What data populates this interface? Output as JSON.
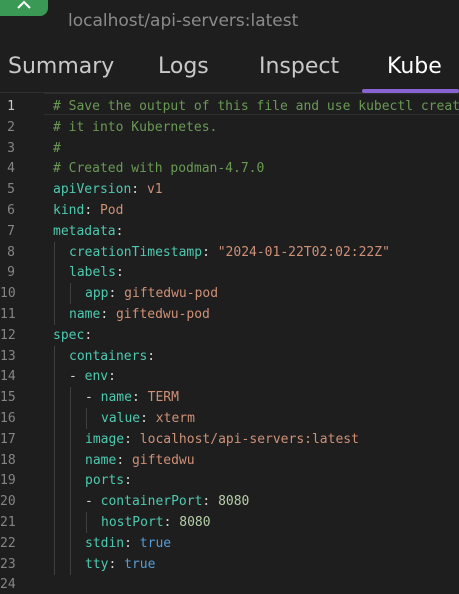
{
  "header": {
    "image_name": "localhost/api-servers:latest"
  },
  "tabs": [
    {
      "label": "Summary"
    },
    {
      "label": "Logs"
    },
    {
      "label": "Inspect"
    },
    {
      "label": "Kube"
    }
  ],
  "active_tab": "Kube",
  "colors": {
    "background": "#1e1e1e",
    "accent": "#8a63d2",
    "container_icon": "#3a9a55",
    "comment": "#6a9955",
    "key": "#4ec9b0",
    "string": "#ce9178",
    "number": "#b5cea8",
    "boolean": "#569cd6"
  },
  "editor": {
    "active_line": 1,
    "lines": [
      {
        "n": "1",
        "indent": 0,
        "tokens": [
          {
            "t": "comment",
            "v": "# Save the output of this file and use kubectl create -f to import"
          }
        ]
      },
      {
        "n": "2",
        "indent": 0,
        "tokens": [
          {
            "t": "comment",
            "v": "# it into Kubernetes."
          }
        ]
      },
      {
        "n": "3",
        "indent": 0,
        "tokens": [
          {
            "t": "comment",
            "v": "#"
          }
        ]
      },
      {
        "n": "4",
        "indent": 0,
        "tokens": [
          {
            "t": "comment",
            "v": "# Created with podman-4.7.0"
          }
        ]
      },
      {
        "n": "5",
        "indent": 0,
        "tokens": [
          {
            "t": "key",
            "v": "apiVersion"
          },
          {
            "t": "punct",
            "v": ": "
          },
          {
            "t": "str",
            "v": "v1"
          }
        ]
      },
      {
        "n": "6",
        "indent": 0,
        "tokens": [
          {
            "t": "key",
            "v": "kind"
          },
          {
            "t": "punct",
            "v": ": "
          },
          {
            "t": "str",
            "v": "Pod"
          }
        ]
      },
      {
        "n": "7",
        "indent": 0,
        "tokens": [
          {
            "t": "key",
            "v": "metadata"
          },
          {
            "t": "punct",
            "v": ":"
          }
        ]
      },
      {
        "n": "8",
        "indent": 1,
        "tokens": [
          {
            "t": "key",
            "v": "creationTimestamp"
          },
          {
            "t": "punct",
            "v": ": "
          },
          {
            "t": "str",
            "v": "\"2024-01-22T02:02:22Z\""
          }
        ]
      },
      {
        "n": "9",
        "indent": 1,
        "tokens": [
          {
            "t": "key",
            "v": "labels"
          },
          {
            "t": "punct",
            "v": ":"
          }
        ]
      },
      {
        "n": "10",
        "indent": 2,
        "tokens": [
          {
            "t": "key",
            "v": "app"
          },
          {
            "t": "punct",
            "v": ": "
          },
          {
            "t": "str",
            "v": "giftedwu-pod"
          }
        ]
      },
      {
        "n": "11",
        "indent": 1,
        "tokens": [
          {
            "t": "key",
            "v": "name"
          },
          {
            "t": "punct",
            "v": ": "
          },
          {
            "t": "str",
            "v": "giftedwu-pod"
          }
        ]
      },
      {
        "n": "12",
        "indent": 0,
        "tokens": [
          {
            "t": "key",
            "v": "spec"
          },
          {
            "t": "punct",
            "v": ":"
          }
        ]
      },
      {
        "n": "13",
        "indent": 1,
        "tokens": [
          {
            "t": "key",
            "v": "containers"
          },
          {
            "t": "punct",
            "v": ":"
          }
        ]
      },
      {
        "n": "14",
        "indent": 1,
        "tokens": [
          {
            "t": "punct",
            "v": "- "
          },
          {
            "t": "key",
            "v": "env"
          },
          {
            "t": "punct",
            "v": ":"
          }
        ]
      },
      {
        "n": "15",
        "indent": 2,
        "tokens": [
          {
            "t": "punct",
            "v": "- "
          },
          {
            "t": "key",
            "v": "name"
          },
          {
            "t": "punct",
            "v": ": "
          },
          {
            "t": "str",
            "v": "TERM"
          }
        ]
      },
      {
        "n": "16",
        "indent": 3,
        "tokens": [
          {
            "t": "key",
            "v": "value"
          },
          {
            "t": "punct",
            "v": ": "
          },
          {
            "t": "str",
            "v": "xterm"
          }
        ]
      },
      {
        "n": "17",
        "indent": 2,
        "tokens": [
          {
            "t": "key",
            "v": "image"
          },
          {
            "t": "punct",
            "v": ": "
          },
          {
            "t": "str",
            "v": "localhost/api-servers:latest"
          }
        ]
      },
      {
        "n": "18",
        "indent": 2,
        "tokens": [
          {
            "t": "key",
            "v": "name"
          },
          {
            "t": "punct",
            "v": ": "
          },
          {
            "t": "str",
            "v": "giftedwu"
          }
        ]
      },
      {
        "n": "19",
        "indent": 2,
        "tokens": [
          {
            "t": "key",
            "v": "ports"
          },
          {
            "t": "punct",
            "v": ":"
          }
        ]
      },
      {
        "n": "20",
        "indent": 2,
        "tokens": [
          {
            "t": "punct",
            "v": "- "
          },
          {
            "t": "key",
            "v": "containerPort"
          },
          {
            "t": "punct",
            "v": ": "
          },
          {
            "t": "num",
            "v": "8080"
          }
        ]
      },
      {
        "n": "21",
        "indent": 3,
        "tokens": [
          {
            "t": "key",
            "v": "hostPort"
          },
          {
            "t": "punct",
            "v": ": "
          },
          {
            "t": "num",
            "v": "8080"
          }
        ]
      },
      {
        "n": "22",
        "indent": 2,
        "tokens": [
          {
            "t": "key",
            "v": "stdin"
          },
          {
            "t": "punct",
            "v": ": "
          },
          {
            "t": "bool",
            "v": "true"
          }
        ]
      },
      {
        "n": "23",
        "indent": 2,
        "tokens": [
          {
            "t": "key",
            "v": "tty"
          },
          {
            "t": "punct",
            "v": ": "
          },
          {
            "t": "bool",
            "v": "true"
          }
        ]
      },
      {
        "n": "24",
        "indent": 0,
        "tokens": []
      }
    ]
  }
}
